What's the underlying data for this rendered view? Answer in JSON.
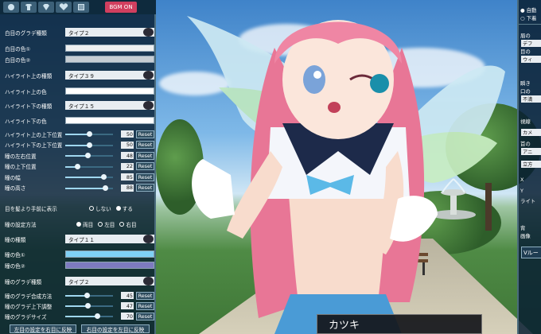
{
  "topbar": {
    "tabs": [
      {
        "icon": "face-icon"
      },
      {
        "icon": "clothes-icon"
      },
      {
        "icon": "gem-icon"
      },
      {
        "icon": "heart-icon"
      },
      {
        "icon": "list-icon"
      }
    ],
    "bgm_label": "BGM ON"
  },
  "left_panel": {
    "sclera_type": {
      "label": "白目のグラデ種類",
      "value": "タイプ２"
    },
    "sclera_color1": {
      "label": "白目の色①"
    },
    "sclera_color2": {
      "label": "白目の色②"
    },
    "highlight_top_type": {
      "label": "ハイライト上の種類",
      "value": "タイプ３９"
    },
    "highlight_top_color": {
      "label": "ハイライト上の色"
    },
    "highlight_bottom_type": {
      "label": "ハイライト下の種類",
      "value": "タイプ１５"
    },
    "highlight_bottom_color": {
      "label": "ハイライト下の色"
    },
    "sliders_a": [
      {
        "label": "ハイライト上の上下位置",
        "value": "50",
        "fraction": 0.5
      },
      {
        "label": "ハイライト下の上下位置",
        "value": "50",
        "fraction": 0.5
      },
      {
        "label": "瞳の左右位置",
        "value": "48",
        "fraction": 0.48
      },
      {
        "label": "瞳の上下位置",
        "value": "22",
        "fraction": 0.22
      },
      {
        "label": "瞳の幅",
        "value": "85",
        "fraction": 0.85
      },
      {
        "label": "瞳の高さ",
        "value": "88",
        "fraction": 0.88
      }
    ],
    "hair_front": {
      "label": "目を髪より手前に表示",
      "opt_off": "しない",
      "opt_on": "する"
    },
    "iris_setting": {
      "label": "瞳の設定方法",
      "opt_both": "両目",
      "opt_left": "左目",
      "opt_right": "右目"
    },
    "iris_type": {
      "label": "瞳の種類",
      "value": "タイプ１１"
    },
    "iris_color1": {
      "label": "瞳の色①"
    },
    "iris_color2": {
      "label": "瞳の色②"
    },
    "iris_grad_type": {
      "label": "瞳のグラデ種類",
      "value": "タイプ２"
    },
    "sliders_b": [
      {
        "label": "瞳のグラデ合成方法",
        "value": "45",
        "fraction": 0.45
      },
      {
        "label": "瞳のグラデ上下調整",
        "value": "47",
        "fraction": 0.47
      },
      {
        "label": "瞳のグラデサイズ",
        "value": "70",
        "fraction": 0.7
      }
    ],
    "reset_label": "Reset",
    "copy_left_to_right": "左目の設定を右目に反映",
    "copy_right_to_left": "右目の設定を左目に反映"
  },
  "right_panel": {
    "auto_label": "自動",
    "down_label": "下着",
    "texts": [
      "眉の",
      "デフ",
      "目の",
      "ウィ",
      "瞬き",
      "口の",
      "不満",
      "視線",
      "カメ",
      "首の",
      "アニ",
      "立方",
      "X",
      "Y",
      "ライト",
      "背",
      "画像",
      "Vルー"
    ]
  },
  "name_box": "カツキ",
  "colors": {
    "panel_bg": "#081e32",
    "sclera1": "#eef0f0",
    "sclera2": "#c6cdd3",
    "hl_top": "#ffffff",
    "hl_bottom": "#ffffff",
    "iris1": "#7fd0f5",
    "iris2": "#7d7ac0",
    "bgm": "#d13f5f"
  }
}
